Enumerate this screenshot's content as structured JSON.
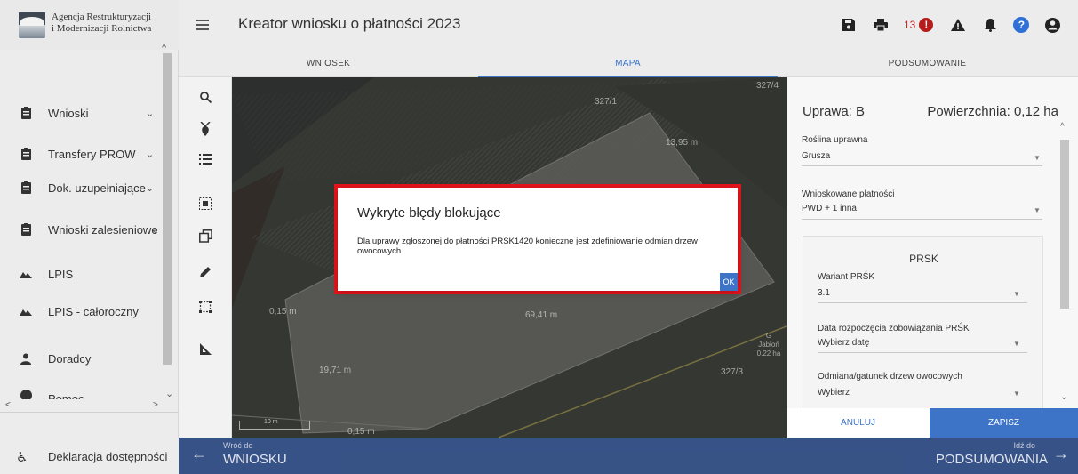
{
  "app": {
    "logo_line1": "Agencja Restrukturyzacji",
    "logo_line2": "i Modernizacji Rolnictwa",
    "title": "Kreator wniosku o płatności 2023"
  },
  "header": {
    "notification_count": "13",
    "icons": [
      "save-icon",
      "print-icon",
      "error-icon",
      "warning-icon",
      "bell-icon",
      "help-icon",
      "account-icon"
    ]
  },
  "tabs": [
    {
      "label": "WNIOSEK"
    },
    {
      "label": "MAPA",
      "active": true
    },
    {
      "label": "PODSUMOWANIE"
    }
  ],
  "sidebar": {
    "items": [
      {
        "label": "Wnioski",
        "icon": "document-icon",
        "has_chevron": true
      },
      {
        "label": "Transfery PROW",
        "icon": "document-icon",
        "has_chevron": true
      },
      {
        "label": "Dok. uzupełniające",
        "icon": "document-icon",
        "has_chevron": true
      },
      {
        "label": "Wnioski zalesieniowe",
        "icon": "document-icon",
        "has_chevron": true
      },
      {
        "label": "LPIS",
        "icon": "terrain-icon",
        "has_chevron": false
      },
      {
        "label": "LPIS - całoroczny",
        "icon": "terrain-icon",
        "has_chevron": false
      },
      {
        "label": "Doradcy",
        "icon": "person-icon",
        "has_chevron": false
      },
      {
        "label": "Pomoc",
        "icon": "help-icon",
        "has_chevron": true
      }
    ],
    "accessibility_label": "Deklaracja dostępności"
  },
  "map": {
    "labels": [
      "327/4",
      "327/1",
      "13,95 m",
      "0,15 m",
      "69,41 m",
      "19,71 m",
      "327/3",
      "0,15 m"
    ],
    "parcel_label": [
      "G",
      "Jabłoń",
      "0.22 ha"
    ],
    "scale": "10 m"
  },
  "panel": {
    "title": "Uprawa: B",
    "area": "Powierzchnia: 0,12 ha",
    "fields": [
      {
        "label": "Roślina uprawna",
        "value": "Grusza"
      },
      {
        "label": "Wnioskowane płatności",
        "value": "PWD + 1 inna"
      }
    ],
    "prsk": {
      "title": "PRSK",
      "fields": [
        {
          "label": "Wariant PRŚK",
          "value": "3.1"
        },
        {
          "label": "Data rozpoczęcia zobowiązania PRŚK",
          "value": "Wybierz datę"
        },
        {
          "label": "Odmiana/gatunek drzew owocowych",
          "value": "Wybierz"
        }
      ]
    },
    "cancel_label": "ANULUJ",
    "save_label": "ZAPISZ"
  },
  "bottom_nav": {
    "back_small": "Wróć do",
    "back_big": "WNIOSKU",
    "forward_small": "Idź do",
    "forward_big": "PODSUMOWANIA"
  },
  "dialog": {
    "title": "Wykryte błędy blokujące",
    "message": "Dla uprawy zgłoszonej do płatności PRSK1420 konieczne jest zdefiniowanie odmian drzew owocowych",
    "ok_label": "OK"
  },
  "colors": {
    "accent": "#3d74c7",
    "highlight_frame": "#e8141b",
    "error": "#b71c1c"
  }
}
